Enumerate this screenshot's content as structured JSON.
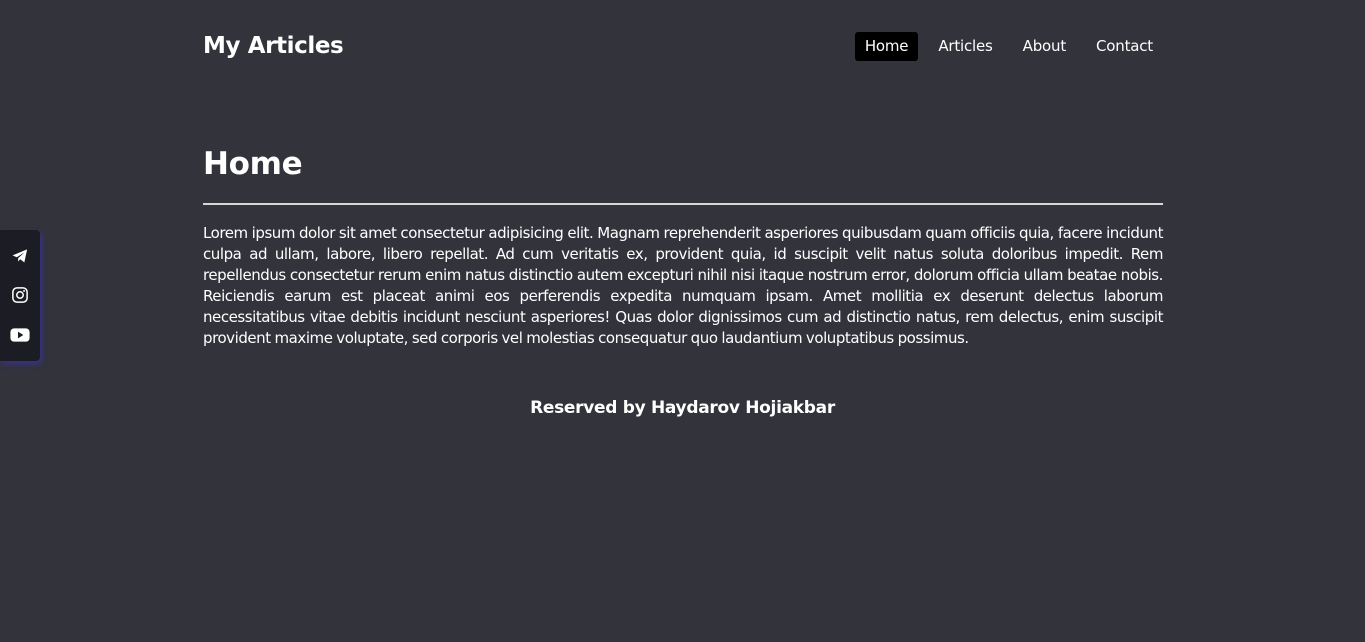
{
  "header": {
    "brand": "My Articles",
    "nav": [
      {
        "label": "Home",
        "active": true
      },
      {
        "label": "Articles",
        "active": false
      },
      {
        "label": "About",
        "active": false
      },
      {
        "label": "Contact",
        "active": false
      }
    ]
  },
  "main": {
    "title": "Home",
    "body": "Lorem ipsum dolor sit amet consectetur adipisicing elit. Magnam reprehenderit asperiores quibusdam quam officiis quia, facere incidunt culpa ad ullam, labore, libero repellat. Ad cum veritatis ex, provident quia, id suscipit velit natus soluta doloribus impedit. Rem repellendus consectetur rerum enim natus distinctio autem excepturi nihil nisi itaque nostrum error, dolorum officia ullam beatae nobis. Reiciendis earum est placeat animi eos perferendis expedita numquam ipsam. Amet mollitia ex deserunt delectus laborum necessitatibus vitae debitis incidunt nesciunt asperiores! Quas dolor dignissimos cum ad distinctio natus, rem delectus, enim suscipit provident maxime voluptate, sed corporis vel molestias consequatur quo laudantium voluptatibus possimus."
  },
  "footer": {
    "text": "Reserved by Haydarov Hojiakbar"
  },
  "social": {
    "icons": [
      "telegram-icon",
      "instagram-icon",
      "youtube-icon"
    ]
  },
  "colors": {
    "background": "#33333c",
    "active_nav": "#000000",
    "social_bar": "#1c1c24",
    "text": "#ffffff"
  }
}
